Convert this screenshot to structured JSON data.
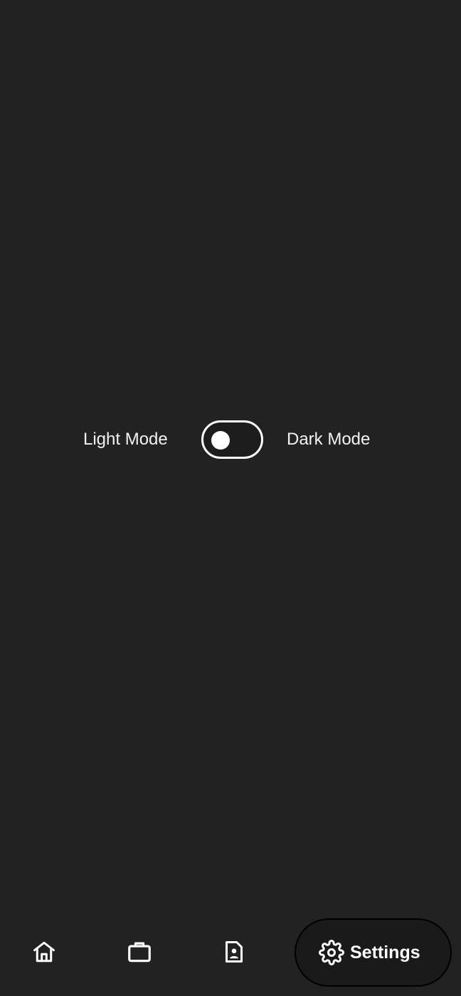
{
  "theme_switch": {
    "light_label": "Light Mode",
    "dark_label": "Dark Mode",
    "is_dark": false
  },
  "bottom_nav": {
    "items": [
      {
        "icon": "home-icon"
      },
      {
        "icon": "briefcase-icon"
      },
      {
        "icon": "contact-file-icon"
      },
      {
        "icon": "gear-icon",
        "label": "Settings",
        "selected": true
      }
    ]
  },
  "colors": {
    "background": "#222222",
    "text": "#ffffff",
    "active_pill": "#1a1a1a"
  }
}
